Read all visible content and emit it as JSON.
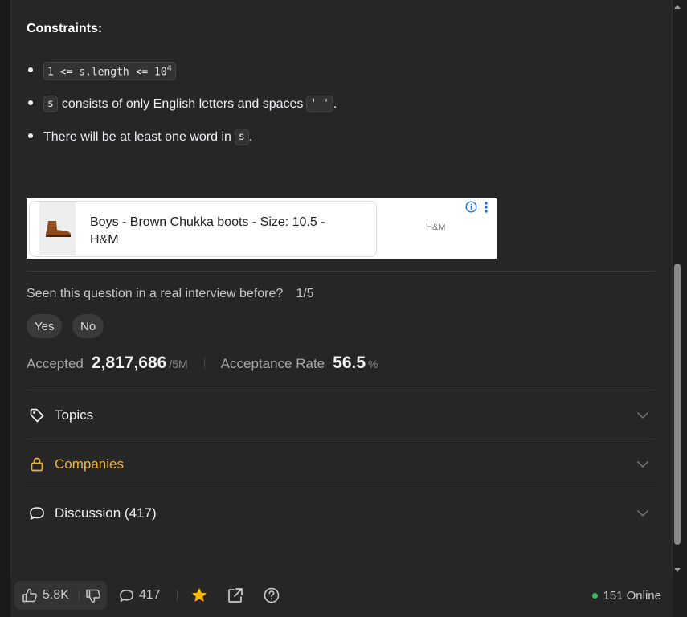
{
  "description": {
    "constraints_heading": "Constraints:",
    "constraint1": {
      "code_pre": "1 <= s.length <= 10",
      "code_sup": "4"
    },
    "constraint2": {
      "code_s": "s",
      "text": "consists of only English letters and spaces",
      "code_space": "' '",
      "end": "."
    },
    "constraint3": {
      "text": "There will be at least one word in",
      "code_s": "s",
      "end": "."
    }
  },
  "ad": {
    "title": "Boys - Brown Chukka boots - Size: 10.5 - H&M",
    "brand": "H&M"
  },
  "feedback": {
    "question": "Seen this question in a real interview before?",
    "ratio": "1/5",
    "yes_label": "Yes",
    "no_label": "No"
  },
  "stats": {
    "accepted_label": "Accepted",
    "accepted_value": "2,817,686",
    "accepted_total": "/5M",
    "rate_label": "Acceptance Rate",
    "rate_value": "56.5",
    "rate_unit": "%"
  },
  "accordion": {
    "topics": "Topics",
    "companies": "Companies",
    "discussion": "Discussion (417)"
  },
  "bottom_bar": {
    "likes": "5.8K",
    "comments": "417",
    "online": "151 Online"
  },
  "colors": {
    "accent_companies": "#ecb341",
    "star": "#ffb800",
    "online_dot": "#2cbb5d"
  },
  "icons": [
    "tag-icon",
    "lock-icon",
    "comment-icon",
    "chevron-down-icon",
    "thumbs-up-icon",
    "thumbs-down-icon",
    "star-icon",
    "share-icon",
    "help-icon",
    "info-icon",
    "kebab-icon"
  ]
}
